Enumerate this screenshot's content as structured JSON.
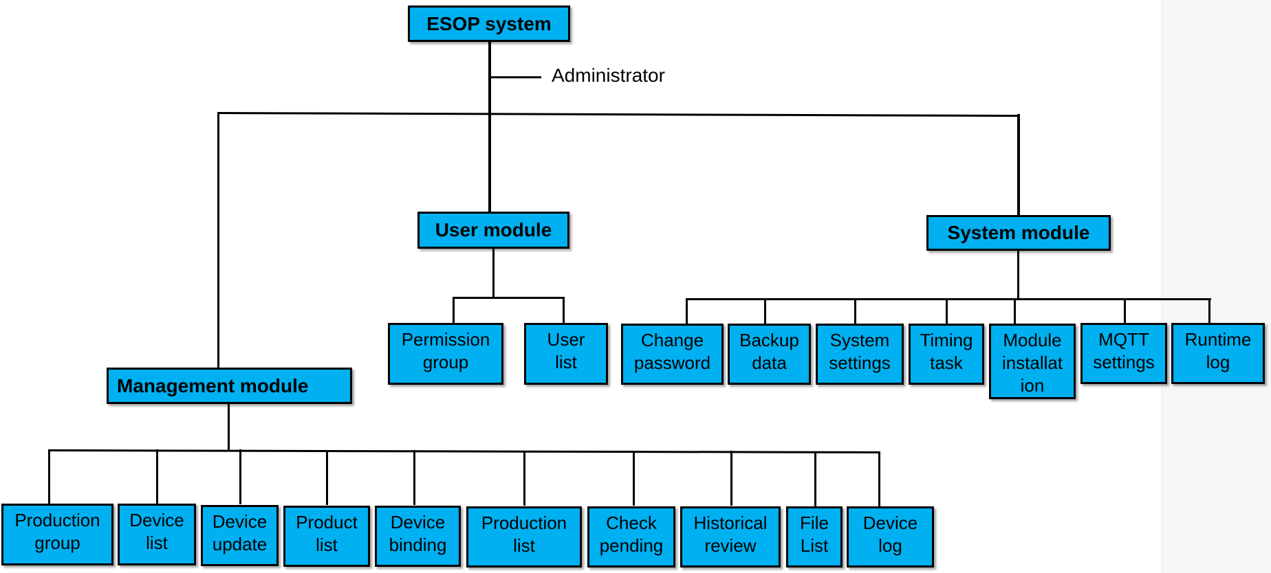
{
  "diagram": {
    "root": {
      "label": "ESOP system",
      "edge_label": "Administrator"
    },
    "modules": [
      {
        "label": "User module",
        "children": [
          "Permission\ngroup",
          "User\nlist"
        ]
      },
      {
        "label": "System module",
        "children": [
          "Change\npassword",
          "Backup\ndata",
          "System\nsettings",
          "Timing\ntask",
          "Module\ninstallat\nion",
          "MQTT\nsettings",
          "Runtime\nlog"
        ]
      },
      {
        "label": "Management module",
        "children": [
          "Production\ngroup",
          "Device\nlist",
          "Device\nupdate",
          "Product\nlist",
          "Device\nbinding",
          "Production\nlist",
          "Check\npending",
          "Historical\nreview",
          "File\nList",
          "Device\nlog"
        ]
      }
    ],
    "colors": {
      "node_fill": "#00b0f0",
      "line": "#000000",
      "panel": "#f5f6f8"
    }
  }
}
